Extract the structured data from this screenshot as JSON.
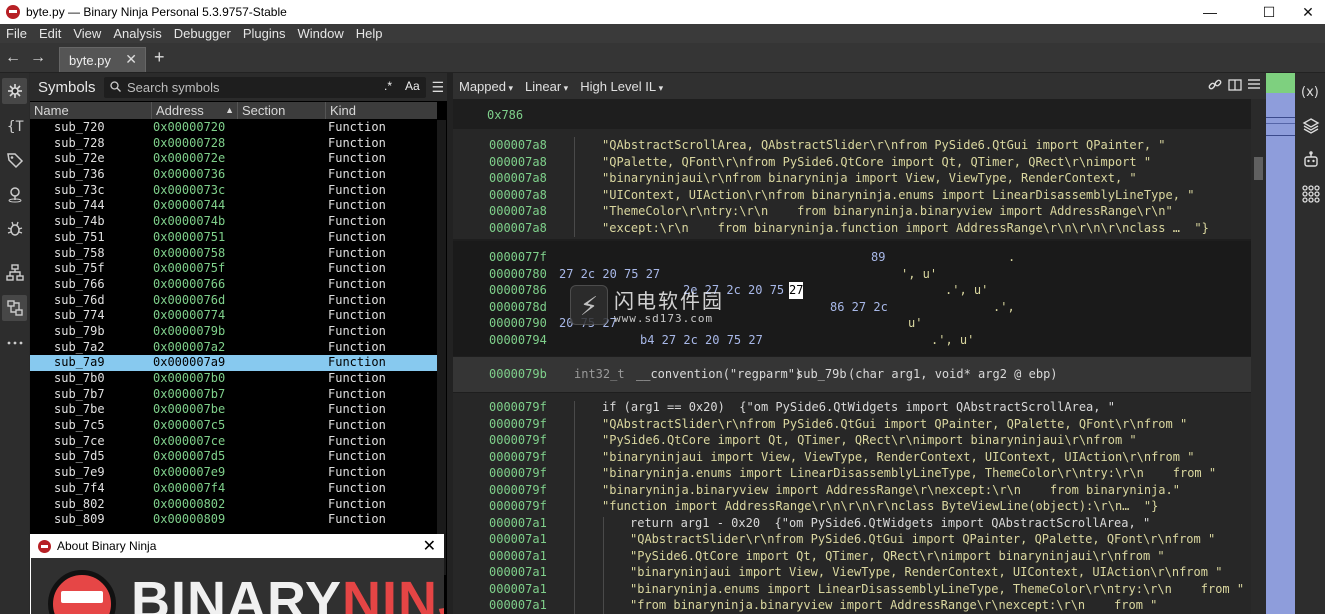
{
  "window": {
    "title": "byte.py — Binary Ninja Personal 5.3.9757-Stable",
    "controls": [
      "—",
      "☐",
      "✕"
    ]
  },
  "menu": [
    "File",
    "Edit",
    "View",
    "Analysis",
    "Debugger",
    "Plugins",
    "Window",
    "Help"
  ],
  "tabs": {
    "active_tab": "byte.py",
    "close_glyph": "✕",
    "add_glyph": "+",
    "back_glyph": "←",
    "forward_glyph": "→"
  },
  "sidebar_icons": [
    "symbols-icon",
    "types-icon",
    "tags-icon",
    "location-icon",
    "debugger-bug-icon",
    "graph-icon",
    "cross-references-icon",
    "more-icon"
  ],
  "symbols": {
    "title": "Symbols",
    "search_placeholder": "Search symbols",
    "regex_glyph": ".*",
    "case_glyph": "Aa",
    "menu_glyph": "☰",
    "columns": [
      "Name",
      "Address",
      "Section",
      "Kind"
    ],
    "selected_index": 15,
    "rows": [
      {
        "name": "sub_720",
        "addr": "0x00000720",
        "kind": "Function"
      },
      {
        "name": "sub_728",
        "addr": "0x00000728",
        "kind": "Function"
      },
      {
        "name": "sub_72e",
        "addr": "0x0000072e",
        "kind": "Function"
      },
      {
        "name": "sub_736",
        "addr": "0x00000736",
        "kind": "Function"
      },
      {
        "name": "sub_73c",
        "addr": "0x0000073c",
        "kind": "Function"
      },
      {
        "name": "sub_744",
        "addr": "0x00000744",
        "kind": "Function"
      },
      {
        "name": "sub_74b",
        "addr": "0x0000074b",
        "kind": "Function"
      },
      {
        "name": "sub_751",
        "addr": "0x00000751",
        "kind": "Function"
      },
      {
        "name": "sub_758",
        "addr": "0x00000758",
        "kind": "Function"
      },
      {
        "name": "sub_75f",
        "addr": "0x0000075f",
        "kind": "Function"
      },
      {
        "name": "sub_766",
        "addr": "0x00000766",
        "kind": "Function"
      },
      {
        "name": "sub_76d",
        "addr": "0x0000076d",
        "kind": "Function"
      },
      {
        "name": "sub_774",
        "addr": "0x00000774",
        "kind": "Function"
      },
      {
        "name": "sub_79b",
        "addr": "0x0000079b",
        "kind": "Function"
      },
      {
        "name": "sub_7a2",
        "addr": "0x000007a2",
        "kind": "Function"
      },
      {
        "name": "sub_7a9",
        "addr": "0x000007a9",
        "kind": "Function"
      },
      {
        "name": "sub_7b0",
        "addr": "0x000007b0",
        "kind": "Function"
      },
      {
        "name": "sub_7b7",
        "addr": "0x000007b7",
        "kind": "Function"
      },
      {
        "name": "sub_7be",
        "addr": "0x000007be",
        "kind": "Function"
      },
      {
        "name": "sub_7c5",
        "addr": "0x000007c5",
        "kind": "Function"
      },
      {
        "name": "sub_7ce",
        "addr": "0x000007ce",
        "kind": "Function"
      },
      {
        "name": "sub_7d5",
        "addr": "0x000007d5",
        "kind": "Function"
      },
      {
        "name": "sub_7e9",
        "addr": "0x000007e9",
        "kind": "Function"
      },
      {
        "name": "sub_7f4",
        "addr": "0x000007f4",
        "kind": "Function"
      },
      {
        "name": "sub_802",
        "addr": "0x00000802",
        "kind": "Function"
      },
      {
        "name": "sub_809",
        "addr": "0x00000809",
        "kind": "Function"
      }
    ]
  },
  "about_dialog": {
    "title": "About Binary Ninja",
    "close_glyph": "✕",
    "brand_part1": "BINARY",
    "brand_part2": "NINJA"
  },
  "view_bar": {
    "mapped": "Mapped",
    "linear": "Linear",
    "il": "High Level IL",
    "icons": [
      "link-icon",
      "split-view-icon",
      "menu-icon"
    ]
  },
  "code": {
    "top_addr": "0x786",
    "block1": [
      {
        "addr": "000007a8",
        "text": "\"QAbstractScrollArea, QAbstractSlider\\r\\nfrom PySide6.QtGui import QPainter, \""
      },
      {
        "addr": "000007a8",
        "text": "\"QPalette, QFont\\r\\nfrom PySide6.QtCore import Qt, QTimer, QRect\\r\\nimport \""
      },
      {
        "addr": "000007a8",
        "text": "\"binaryninjaui\\r\\nfrom binaryninja import View, ViewType, RenderContext, \""
      },
      {
        "addr": "000007a8",
        "text": "\"UIContext, UIAction\\r\\nfrom binaryninja.enums import LinearDisassemblyLineType, \""
      },
      {
        "addr": "000007a8",
        "text": "\"ThemeColor\\r\\ntry:\\r\\n    from binaryninja.binaryview import AddressRange\\r\\n\""
      },
      {
        "addr": "000007a8",
        "text": "\"except:\\r\\n    from binaryninja.function import AddressRange\\r\\n\\r\\n\\r\\nclass …  \"}"
      }
    ],
    "hex_rows": [
      {
        "addr": "0000077f",
        "bytes": "",
        "ascii": "89",
        "tail": "."
      },
      {
        "addr": "00000780",
        "bytes": "27 2c 20 75 27",
        "ascii": "",
        "tail": "', u'"
      },
      {
        "addr": "00000786",
        "bytes": "2e 27 2c 20 75",
        "ascii": "27",
        "tail": ".', u'"
      },
      {
        "addr": "0000078d",
        "bytes": "",
        "ascii": "86 27 2c",
        "tail": ".',"
      },
      {
        "addr": "00000790",
        "bytes": "20 75 27",
        "ascii": "",
        "tail": "u'"
      },
      {
        "addr": "00000794",
        "bytes": "b4 27 2c 20 75 27",
        "ascii": "",
        "tail": ".', u'"
      }
    ],
    "func_header": {
      "addr": "0000079b",
      "ret_type": "int32_t",
      "convention": "__convention(\"regparm\")",
      "name": "sub_79b",
      "args": "(char arg1, void* arg2 @ ebp)"
    },
    "block2": [
      {
        "addr": "0000079f",
        "indent": 0,
        "text": "if (arg1 == 0x20)  {\"om PySide6.QtWidgets import QAbstractScrollArea, \""
      },
      {
        "addr": "0000079f",
        "indent": 0,
        "text": "\"QAbstractSlider\\r\\nfrom PySide6.QtGui import QPainter, QPalette, QFont\\r\\nfrom \""
      },
      {
        "addr": "0000079f",
        "indent": 0,
        "text": "\"PySide6.QtCore import Qt, QTimer, QRect\\r\\nimport binaryninjaui\\r\\nfrom \""
      },
      {
        "addr": "0000079f",
        "indent": 0,
        "text": "\"binaryninjaui import View, ViewType, RenderContext, UIContext, UIAction\\r\\nfrom \""
      },
      {
        "addr": "0000079f",
        "indent": 0,
        "text": "\"binaryninja.enums import LinearDisassemblyLineType, ThemeColor\\r\\ntry:\\r\\n    from \""
      },
      {
        "addr": "0000079f",
        "indent": 0,
        "text": "\"binaryninja.binaryview import AddressRange\\r\\nexcept:\\r\\n    from binaryninja.\""
      },
      {
        "addr": "0000079f",
        "indent": 0,
        "text": "\"function import AddressRange\\r\\n\\r\\n\\r\\nclass ByteViewLine(object):\\r\\n…  \"}"
      },
      {
        "addr": "000007a1",
        "indent": 1,
        "text": "return arg1 - 0x20  {\"om PySide6.QtWidgets import QAbstractScrollArea, \""
      },
      {
        "addr": "000007a1",
        "indent": 1,
        "text": "\"QAbstractSlider\\r\\nfrom PySide6.QtGui import QPainter, QPalette, QFont\\r\\nfrom \""
      },
      {
        "addr": "000007a1",
        "indent": 1,
        "text": "\"PySide6.QtCore import Qt, QTimer, QRect\\r\\nimport binaryninjaui\\r\\nfrom \""
      },
      {
        "addr": "000007a1",
        "indent": 1,
        "text": "\"binaryninjaui import View, ViewType, RenderContext, UIContext, UIAction\\r\\nfrom \""
      },
      {
        "addr": "000007a1",
        "indent": 1,
        "text": "\"binaryninja.enums import LinearDisassemblyLineType, ThemeColor\\r\\ntry:\\r\\n    from \""
      },
      {
        "addr": "000007a1",
        "indent": 1,
        "text": "\"from binaryninja.binaryview import AddressRange\\r\\nexcept:\\r\\n    from \""
      }
    ]
  },
  "watermark": {
    "icon_glyph": "⚡",
    "text": "闪电软件园",
    "sub": "www.sd173.com"
  },
  "right_icons": [
    "variables-icon",
    "layers-icon",
    "robot-icon",
    "graph-grid-icon"
  ],
  "colors": {
    "address_green": "#7fd08b",
    "string_yellow": "#dad79f",
    "selection_blue": "#87c9ef",
    "brand_red": "#e54545"
  }
}
